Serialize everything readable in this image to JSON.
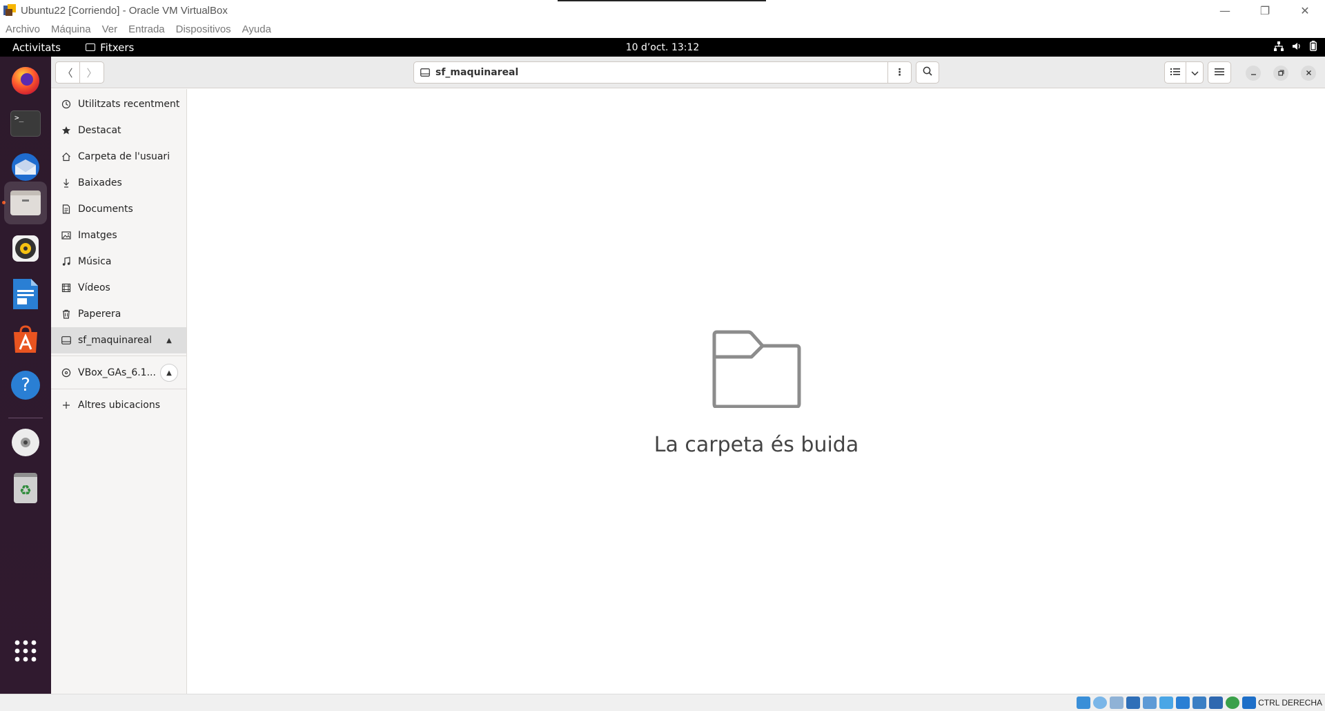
{
  "vbox": {
    "title": "Ubuntu22 [Corriendo] - Oracle VM VirtualBox",
    "window_controls": {
      "minimize": "—",
      "restore": "❐",
      "close": "✕"
    },
    "menu": [
      "Archivo",
      "Máquina",
      "Ver",
      "Entrada",
      "Dispositivos",
      "Ayuda"
    ],
    "host_key": "CTRL DERECHA"
  },
  "topbar": {
    "activities": "Activitats",
    "app_name": "Fitxers",
    "clock": "10 d’oct.  13:12"
  },
  "dock": {
    "apps": [
      "firefox-icon",
      "terminal-icon",
      "thunderbird-icon",
      "files-icon",
      "rhythmbox-icon",
      "libreoffice-writer-icon",
      "app-center-icon",
      "help-icon",
      "dvd-icon",
      "trash-icon",
      "show-apps-icon"
    ],
    "terminal_prompt": ">_",
    "help_glyph": "?",
    "trash_glyph": "♻"
  },
  "files": {
    "path": "sf_maquinareal",
    "back_glyph": "〈",
    "forward_glyph": "〉",
    "menu_glyph": "⋮",
    "sidebar": [
      {
        "label": "Utilitzats recentment",
        "icon": "recent-icon"
      },
      {
        "label": "Destacat",
        "icon": "star-icon"
      },
      {
        "label": "Carpeta de l'usuari",
        "icon": "home-icon"
      },
      {
        "label": "Baixades",
        "icon": "download-icon"
      },
      {
        "label": "Documents",
        "icon": "document-icon"
      },
      {
        "label": "Imatges",
        "icon": "image-icon"
      },
      {
        "label": "Música",
        "icon": "music-icon"
      },
      {
        "label": "Vídeos",
        "icon": "video-icon"
      },
      {
        "label": "Paperera",
        "icon": "trash-icon"
      },
      {
        "label": "sf_maquinareal",
        "icon": "drive-icon"
      },
      {
        "label": "VBox_GAs_6.1...",
        "icon": "disc-icon"
      },
      {
        "label": "Altres ubicacions",
        "icon": "plus-icon"
      }
    ],
    "eject_glyph": "▲",
    "empty_message": "La carpeta és buida"
  },
  "colors": {
    "ubuntu_orange": "#e95420",
    "dock_bg": "#2d1a2c",
    "topbar_bg": "#000000"
  }
}
